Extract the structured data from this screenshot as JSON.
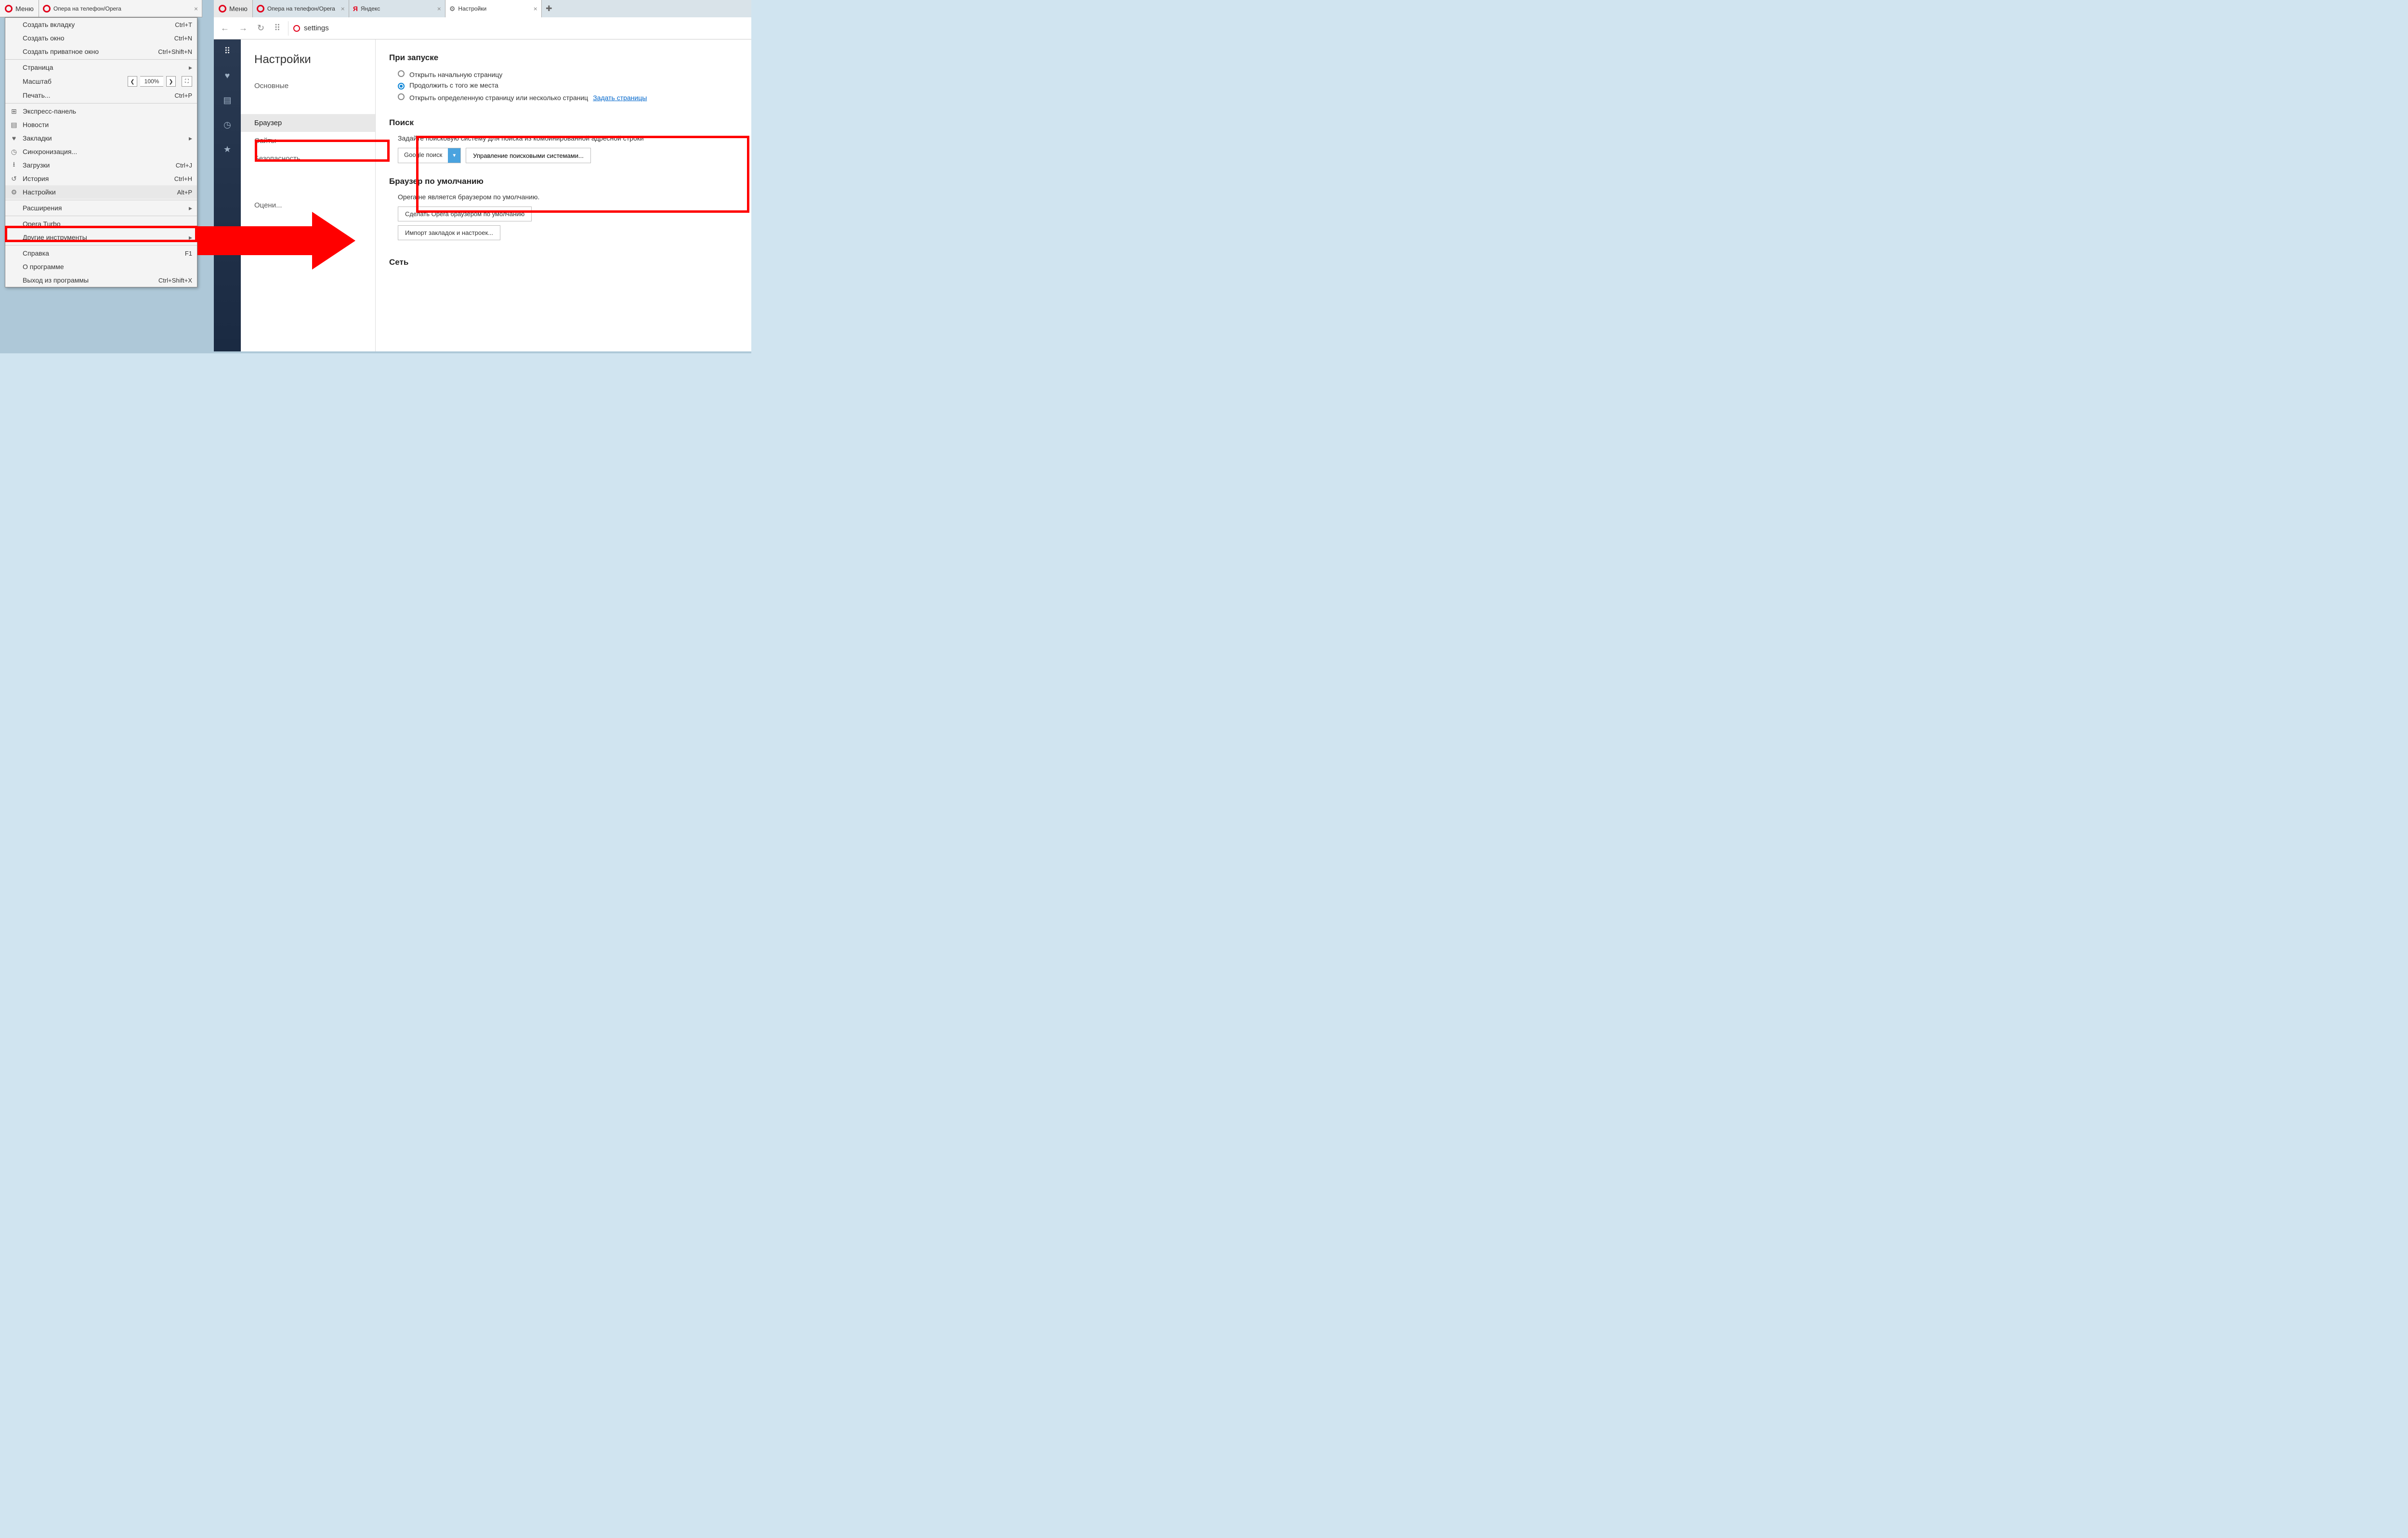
{
  "left": {
    "menu_label": "Меню",
    "tab_title": "Опера на телефон/Opera",
    "items": [
      {
        "icon": "",
        "label": "Создать вкладку",
        "shortcut": "Ctrl+T",
        "sub": false
      },
      {
        "icon": "",
        "label": "Создать окно",
        "shortcut": "Ctrl+N",
        "sub": false
      },
      {
        "icon": "",
        "label": "Создать приватное окно",
        "shortcut": "Ctrl+Shift+N",
        "sub": false
      },
      {
        "sep": true
      },
      {
        "icon": "",
        "label": "Страница",
        "shortcut": "",
        "sub": true
      },
      {
        "zoom": true,
        "label": "Масштаб",
        "value": "100%"
      },
      {
        "icon": "",
        "label": "Печать...",
        "shortcut": "Ctrl+P",
        "sub": false
      },
      {
        "sep": true
      },
      {
        "icon": "speed",
        "label": "Экспресс-панель",
        "shortcut": "",
        "sub": false
      },
      {
        "icon": "news",
        "label": "Новости",
        "shortcut": "",
        "sub": false
      },
      {
        "icon": "heart",
        "label": "Закладки",
        "shortcut": "",
        "sub": true
      },
      {
        "icon": "clock",
        "label": "Синхронизация...",
        "shortcut": "",
        "sub": false
      },
      {
        "icon": "download",
        "label": "Загрузки",
        "shortcut": "Ctrl+J",
        "sub": false
      },
      {
        "icon": "history",
        "label": "История",
        "shortcut": "Ctrl+H",
        "sub": false
      },
      {
        "icon": "gear",
        "label": "Настройки",
        "shortcut": "Alt+P",
        "sub": false,
        "hl": true
      },
      {
        "sep": true
      },
      {
        "icon": "",
        "label": "Расширения",
        "shortcut": "",
        "sub": true
      },
      {
        "sep": true
      },
      {
        "icon": "",
        "label": "Opera Turbo",
        "shortcut": "",
        "sub": false
      },
      {
        "icon": "",
        "label": "Другие инструменты",
        "shortcut": "",
        "sub": true
      },
      {
        "sep": true
      },
      {
        "icon": "",
        "label": "Справка",
        "shortcut": "F1",
        "sub": false
      },
      {
        "icon": "",
        "label": "О программе",
        "shortcut": "",
        "sub": false
      },
      {
        "icon": "",
        "label": "Выход из программы",
        "shortcut": "Ctrl+Shift+X",
        "sub": false
      }
    ]
  },
  "right": {
    "menu_label": "Меню",
    "tabs": [
      {
        "icon": "opera",
        "label": "Опера на телефон/Opera",
        "active": false
      },
      {
        "icon": "yandex",
        "label": "Яндекс",
        "active": false
      },
      {
        "icon": "gear",
        "label": "Настройки",
        "active": true
      }
    ],
    "address": "settings",
    "settings_title": "Настройки",
    "nav_items": [
      {
        "label": "Основные",
        "active": false
      },
      {
        "label": "Браузер",
        "active": true
      },
      {
        "label": "Сайты",
        "active": false
      },
      {
        "label": "Безопасность",
        "active": false
      },
      {
        "label": "Оцени...",
        "active": false
      }
    ],
    "startup": {
      "heading": "При запуске",
      "r1": "Открыть начальную страницу",
      "r2": "Продолжить с того же места",
      "r3": "Открыть определенную страницу или несколько страниц",
      "r3_link": "Задать страницы"
    },
    "search": {
      "heading": "Поиск",
      "note": "Задайте поисковую систему для поиска из комбинированной адресной строки",
      "selected": "Google поиск",
      "manage_btn": "Управление поисковыми системами..."
    },
    "default_browser": {
      "heading": "Браузер по умолчанию",
      "note": "Opera не является браузером по умолчанию.",
      "btn1": "Сделать Opera браузером по умолчанию",
      "btn2": "Импорт закладок и настроек..."
    },
    "network": {
      "heading": "Сеть"
    }
  },
  "icons": {
    "speed": "⊞",
    "news": "▤",
    "heart": "♥",
    "clock": "◷",
    "download": "⭳",
    "history": "↺",
    "gear": "⚙",
    "star": "★",
    "grid": "⠿",
    "reload": "↻",
    "back": "←",
    "fwd": "→",
    "speeddial": "⠿"
  }
}
